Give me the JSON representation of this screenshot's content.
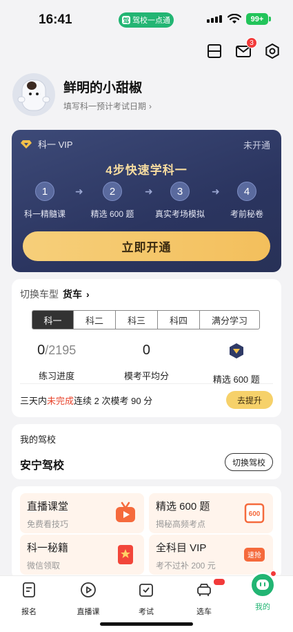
{
  "status_bar": {
    "time": "16:41",
    "app_pill": "驾校一点通",
    "battery": "99+"
  },
  "header": {
    "notification_count": "3"
  },
  "profile": {
    "nickname": "鲜明的小甜椒",
    "sub_link": "填写科一预计考试日期"
  },
  "vip": {
    "label": "科一 VIP",
    "status": "未开通",
    "title": "4步快速学科一",
    "steps": [
      {
        "num": "1",
        "label": "科一精髓课"
      },
      {
        "num": "2",
        "label": "精选 600 题"
      },
      {
        "num": "3",
        "label": "真实考场模拟"
      },
      {
        "num": "4",
        "label": "考前秘卷"
      }
    ],
    "button": "立即开通"
  },
  "progress": {
    "switch_label": "切换车型",
    "car_type": "货车",
    "tabs": [
      "科一",
      "科二",
      "科三",
      "科四",
      "满分学习"
    ],
    "active_tab": "科一",
    "practice_done": "0",
    "practice_total": "/2195",
    "practice_label": "练习进度",
    "mock_avg": "0",
    "mock_label": "模考平均分",
    "select600_label": "精选 600 题",
    "tip_prefix": "三天内",
    "tip_warn": "未完成",
    "tip_suffix": "连续 2 次模考 90 分",
    "improve_button": "去提升"
  },
  "school": {
    "label": "我的驾校",
    "name": "安宁驾校",
    "switch_button": "切换驾校"
  },
  "promos": [
    {
      "title": "直播课堂",
      "sub": "免费看技巧",
      "icon": "tv-icon"
    },
    {
      "title": "精选 600 题",
      "sub": "揭秘高频考点",
      "icon": "600-badge-icon"
    },
    {
      "title": "科一秘籍",
      "sub": "微信领取",
      "icon": "star-book-icon"
    },
    {
      "title": "全科目 VIP",
      "sub": "考不过补 200 元",
      "icon": "speed-stamp-icon"
    }
  ],
  "promo_badges": {
    "stamp": "速抢",
    "num600": "600"
  },
  "tabbar": [
    {
      "label": "报名",
      "icon": "form-icon"
    },
    {
      "label": "直播课",
      "icon": "play-icon"
    },
    {
      "label": "考试",
      "icon": "check-board-icon"
    },
    {
      "label": "选车",
      "icon": "car-icon"
    },
    {
      "label": "我的",
      "icon": "me-icon"
    }
  ],
  "colors": {
    "brand_green": "#22b573",
    "vip_navy": "#2b3560",
    "vip_gold": "#f6dca0",
    "warn_red": "#e8452d",
    "button_yellow": "#f6d16a"
  }
}
